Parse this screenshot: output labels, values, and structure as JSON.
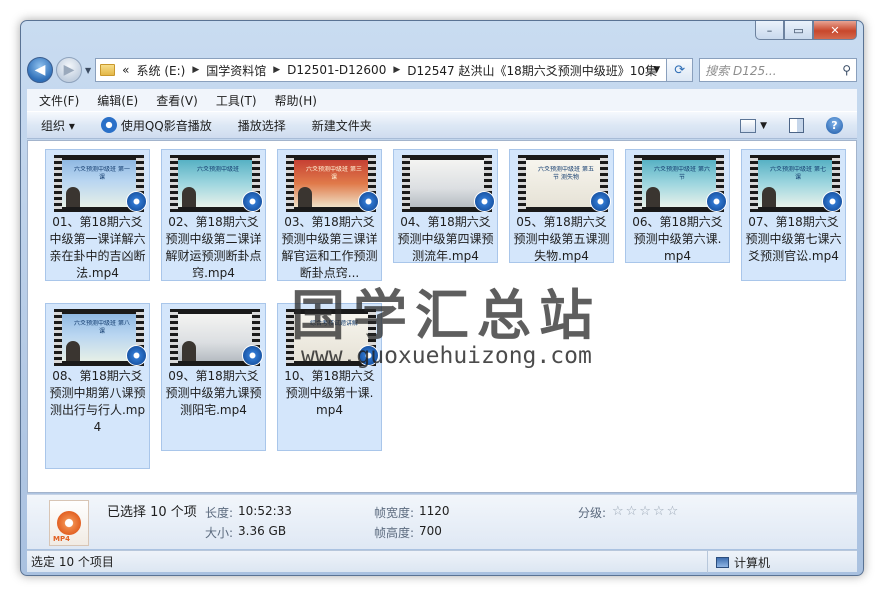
{
  "window": {
    "caption_buttons": {
      "minimize": "–",
      "maximize": "▭",
      "close": "✕"
    }
  },
  "address": {
    "overflow": "«",
    "crumbs": [
      "系统 (E:)",
      "国学资料馆",
      "D12501-D12600",
      "D12547 赵洪山《18期六爻预测中级班》10集"
    ],
    "search_placeholder": "搜索 D125..."
  },
  "menu": [
    "文件(F)",
    "编辑(E)",
    "查看(V)",
    "工具(T)",
    "帮助(H)"
  ],
  "toolbar": {
    "organize": "组织 ▾",
    "play_qq": "使用QQ影音播放",
    "play_selected": "播放选择",
    "new_folder": "新建文件夹"
  },
  "files": [
    {
      "label": "01、第18期六爻中级第一课详解六亲在卦中的吉凶断法.mp4",
      "thumb_text": "六爻预测中级班 第一课"
    },
    {
      "label": "02、第18期六爻预测中级第二课详解财运预测断卦点窍.mp4",
      "thumb_text": "六爻预测中级班"
    },
    {
      "label": "03、第18期六爻预测中级第三课详解官运和工作预测断卦点窍...",
      "thumb_text": "六爻预测中级班 第三课"
    },
    {
      "label": "04、第18期六爻预测中级第四课预测流年.mp4",
      "thumb_text": ""
    },
    {
      "label": "05、第18期六爻预测中级第五课测失物.mp4",
      "thumb_text": "六爻预测中级班 第五节 测失物"
    },
    {
      "label": "06、第18期六爻预测中级第六课.mp4",
      "thumb_text": "六爻预测中级班 第六节"
    },
    {
      "label": "07、第18期六爻预测中级第七课六爻预测官讼.mp4",
      "thumb_text": "六爻预测中级班 第七课"
    },
    {
      "label": "08、第18期六爻预测中期第八课预测出行与行人.mp4",
      "thumb_text": "六爻预测中级班 第八课"
    },
    {
      "label": "09、第18期六爻预测中级第九课预测阳宅.mp4",
      "thumb_text": ""
    },
    {
      "label": "10、第18期六爻预测中级第十课.mp4",
      "thumb_text": "综合考核试题讲解"
    }
  ],
  "watermark": {
    "title": "国学汇总站",
    "url": "www.guoxuehuizong.com"
  },
  "details": {
    "icon_ext": "MP4",
    "selected": "已选择 10 个项",
    "length_key": "长度:",
    "length_val": "10:52:33",
    "size_key": "大小:",
    "size_val": "3.36 GB",
    "width_key": "帧宽度:",
    "width_val": "1120",
    "height_key": "帧高度:",
    "height_val": "700",
    "rating_key": "分级:",
    "rating_stars": "☆☆☆☆☆"
  },
  "status": {
    "left": "选定 10 个项目",
    "right": "计算机"
  }
}
